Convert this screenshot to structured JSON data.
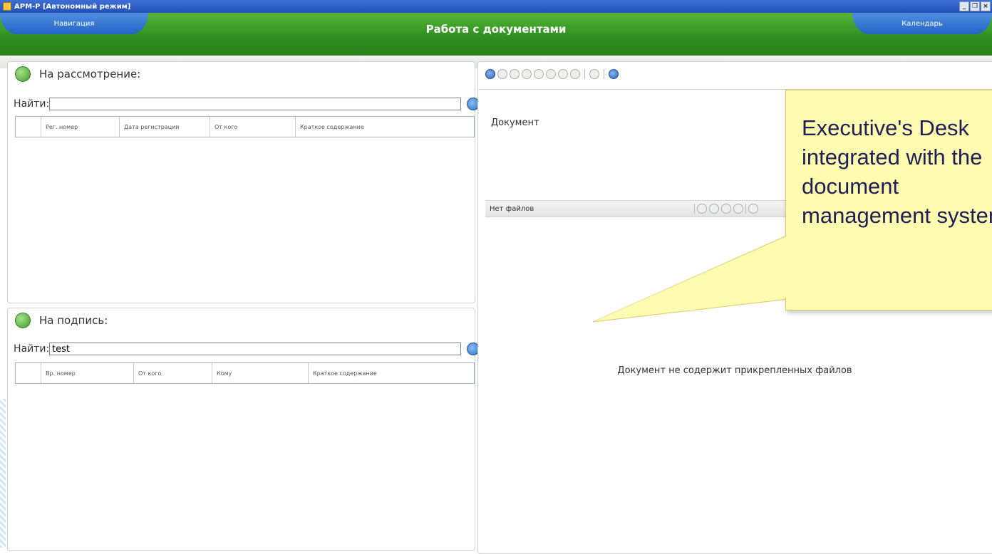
{
  "window": {
    "title": "АРМ-Р [Автономный режим]",
    "controls": [
      "_",
      "❐",
      "×"
    ]
  },
  "header": {
    "nav_left": "Навигация",
    "title": "Работа с документами",
    "nav_right": "Календарь"
  },
  "review_panel": {
    "title": "На рассмотрение:",
    "search_label": "Найти:",
    "search_value": "",
    "columns": [
      "Рег. номер",
      "Дата регистрации",
      "От кого",
      "Краткое содержание"
    ]
  },
  "sign_panel": {
    "title": "На подпись:",
    "search_label": "Найти:",
    "search_value": "test",
    "columns": [
      "Вр. номер",
      "От кого",
      "Кому",
      "Краткое содержание"
    ]
  },
  "document_panel": {
    "doc_label": "Документ",
    "files_label": "Нет файлов",
    "empty_message": "Документ не содержит прикрепленных файлов"
  },
  "callout": {
    "text": "Executive's Desk\nintegrated with the\ndocument\nmanagement system"
  },
  "colors": {
    "header_green": "#2f8f1f",
    "nav_blue": "#2563c6",
    "callout_fill": "#fffbb0",
    "callout_text": "#1f1f55"
  }
}
